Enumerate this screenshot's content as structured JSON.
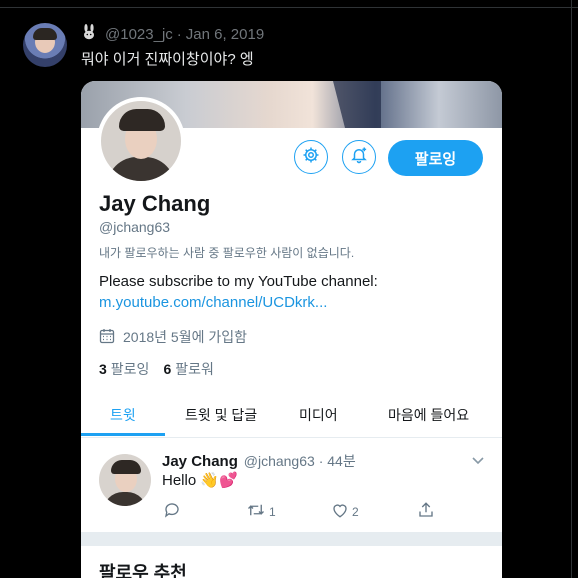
{
  "outer_tweet": {
    "handle": "@1023_jc",
    "sep": "·",
    "date": "Jan 6, 2019",
    "text": "뭐야 이거 진짜이창이야? 엥",
    "badge_icon": "rabbit-icon"
  },
  "profile": {
    "name": "Jay Chang",
    "handle": "@jchang63",
    "mutual_note": "내가 팔로우하는 사람 중 팔로우한 사람이 없습니다.",
    "bio": "Please subscribe to my YouTube channel:",
    "link": "m.youtube.com/channel/UCDkrk...",
    "joined": "2018년 5월에 가입함",
    "following_count": "3",
    "following_label": "팔로잉",
    "followers_count": "6",
    "followers_label": "팔로워",
    "follow_button": "팔로잉"
  },
  "tabs": [
    "트윗",
    "트윗 및 답글",
    "미디어",
    "마음에 들어요"
  ],
  "active_tab": "트윗",
  "tweet": {
    "name": "Jay Chang",
    "handle": "@jchang63",
    "sep": "·",
    "time": "44분",
    "text": "Hello 👋💕",
    "retweets": "1",
    "likes": "2"
  },
  "suggestions_title": "팔로우 추천",
  "colors": {
    "accent": "#1da1f2",
    "link": "#1b95e0",
    "muted": "#657786"
  }
}
